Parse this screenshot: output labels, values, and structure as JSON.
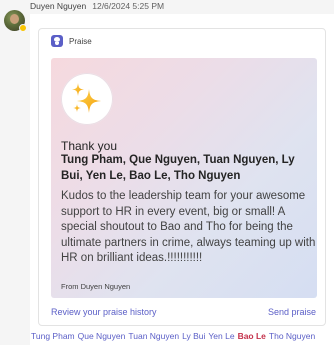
{
  "message": {
    "author": "Duyen Nguyen",
    "timestamp": "12/6/2024 5:25 PM",
    "avatar_status_color": "#f8c400"
  },
  "praise_card": {
    "app_name": "Praise",
    "app_icon": "praise-icon",
    "badge_icon": "sparkles-icon",
    "badge_colors": [
      "#f7b500",
      "#fcd34d"
    ],
    "thank_you": "Thank you",
    "recipients": "Tung Pham, Que Nguyen, Tuan Nguyen, Ly Bui, Yen Le, Bao Le, Tho Nguyen",
    "body": "Kudos to the leadership team for your awesome support to HR in every event, big or small! A special shoutout to Bao and Tho for being the ultimate partners in crime, always teaming up with HR on brilliant ideas.!!!!!!!!!!!",
    "from": "From Duyen Nguyen",
    "review_link": "Review your praise history",
    "send_link": "Send praise"
  },
  "mentions": [
    {
      "name": "Tung Pham",
      "is_me": false
    },
    {
      "name": "Que Nguyen",
      "is_me": false
    },
    {
      "name": "Tuan Nguyen",
      "is_me": false
    },
    {
      "name": "Ly Bui",
      "is_me": false
    },
    {
      "name": "Yen Le",
      "is_me": false
    },
    {
      "name": "Bao Le",
      "is_me": true
    },
    {
      "name": "Tho Nguyen",
      "is_me": false
    }
  ]
}
